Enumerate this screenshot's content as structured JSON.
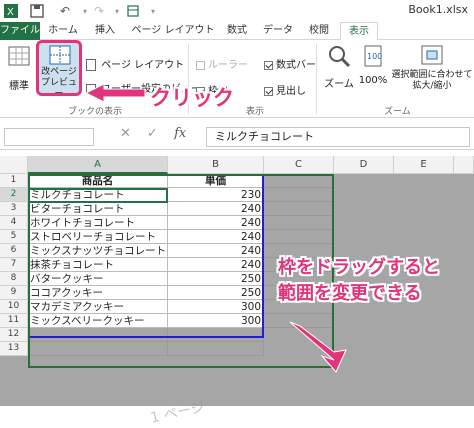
{
  "window": {
    "title": "Book1.xlsx"
  },
  "ribbon_tabs": [
    "ファイル",
    "ホーム",
    "挿入",
    "ページ レイアウト",
    "数式",
    "データ",
    "校閲",
    "表示"
  ],
  "ribbon": {
    "normal_label": "標準",
    "pagebreak_label_1": "改ページ",
    "pagebreak_label_2": "プレビュー",
    "page_layout_label": "ページ レイアウト",
    "user_view_label": "ユーザー設定のビュー",
    "ruler_label": "ルーラー",
    "formula_bar_label": "数式バー",
    "gridlines_label": "枠線",
    "headings_label": "見出し",
    "zoom_label": "ズーム",
    "zoom100_label": "100%",
    "zoom_selection_label_1": "選択範囲に合わせて",
    "zoom_selection_label_2": "拡大/縮小",
    "group_workbook_views": "ブックの表示",
    "group_show": "表示",
    "group_zoom": "ズーム"
  },
  "formula_bar": {
    "namebox": "",
    "fx": "fx",
    "value": "ミルクチョコレート"
  },
  "columns": [
    "A",
    "B",
    "C",
    "D",
    "E"
  ],
  "rows": [
    "1",
    "2",
    "3",
    "4",
    "5",
    "6",
    "7",
    "8",
    "9",
    "10",
    "11",
    "12",
    "13"
  ],
  "table": {
    "header": [
      "商品名",
      "単価"
    ],
    "data": [
      [
        "ミルクチョコレート",
        "230"
      ],
      [
        "ビターチョコレート",
        "240"
      ],
      [
        "ホワイトチョコレート",
        "240"
      ],
      [
        "ストロベリーチョコレート",
        "240"
      ],
      [
        "ミックスナッツチョコレート",
        "240"
      ],
      [
        "抹茶チョコレート",
        "240"
      ],
      [
        "バタークッキー",
        "250"
      ],
      [
        "ココアクッキー",
        "250"
      ],
      [
        "マカデミアクッキー",
        "300"
      ],
      [
        "ミックスベリークッキー",
        "300"
      ]
    ]
  },
  "watermark": "1 ページ",
  "annotations": {
    "click": "クリック",
    "drag_line1": "枠をドラッグすると",
    "drag_line2": "範囲を変更できる"
  },
  "colors": {
    "excel_green": "#217346",
    "accent_pink": "#e2347b",
    "print_border_blue": "#1f1fd0"
  }
}
